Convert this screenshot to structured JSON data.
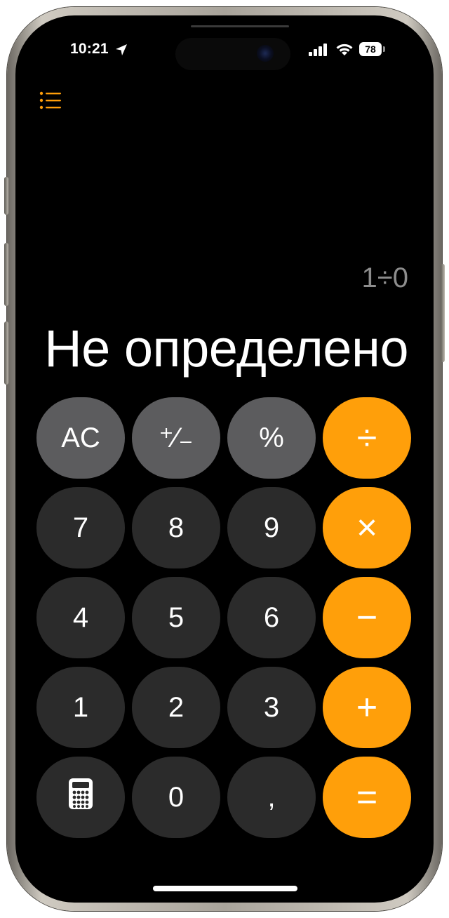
{
  "status_bar": {
    "time": "10:21",
    "battery_level": "78",
    "icons": [
      "location-arrow-icon",
      "cellular-signal-icon",
      "wifi-icon",
      "battery-icon"
    ]
  },
  "toolbar": {
    "history_icon": "list-icon"
  },
  "display": {
    "expression": "1÷0",
    "result": "Не определено"
  },
  "keypad": {
    "rows": [
      [
        {
          "label": "AC",
          "kind": "fn",
          "name": "all-clear-button"
        },
        {
          "label": "⁺∕₋",
          "kind": "fn",
          "name": "plus-minus-button"
        },
        {
          "label": "%",
          "kind": "fn",
          "name": "percent-button"
        },
        {
          "label": "÷",
          "kind": "op",
          "name": "divide-button"
        }
      ],
      [
        {
          "label": "7",
          "kind": "num",
          "name": "digit-7-button"
        },
        {
          "label": "8",
          "kind": "num",
          "name": "digit-8-button"
        },
        {
          "label": "9",
          "kind": "num",
          "name": "digit-9-button"
        },
        {
          "label": "×",
          "kind": "op",
          "name": "multiply-button"
        }
      ],
      [
        {
          "label": "4",
          "kind": "num",
          "name": "digit-4-button"
        },
        {
          "label": "5",
          "kind": "num",
          "name": "digit-5-button"
        },
        {
          "label": "6",
          "kind": "num",
          "name": "digit-6-button"
        },
        {
          "label": "−",
          "kind": "op",
          "name": "minus-button"
        }
      ],
      [
        {
          "label": "1",
          "kind": "num",
          "name": "digit-1-button"
        },
        {
          "label": "2",
          "kind": "num",
          "name": "digit-2-button"
        },
        {
          "label": "3",
          "kind": "num",
          "name": "digit-3-button"
        },
        {
          "label": "+",
          "kind": "op",
          "name": "plus-button"
        }
      ],
      [
        {
          "label": "",
          "kind": "num",
          "name": "calculator-mode-button",
          "icon": "calculator-icon"
        },
        {
          "label": "0",
          "kind": "num",
          "name": "digit-0-button"
        },
        {
          "label": ",",
          "kind": "num",
          "name": "decimal-comma-button"
        },
        {
          "label": "=",
          "kind": "op",
          "name": "equals-button"
        }
      ]
    ]
  },
  "colors": {
    "accent_orange": "#ff9f0a",
    "function_gray": "#5c5c5e",
    "number_dark": "#2b2b2b",
    "expression_gray": "#8d8d8d",
    "background": "#000000"
  }
}
